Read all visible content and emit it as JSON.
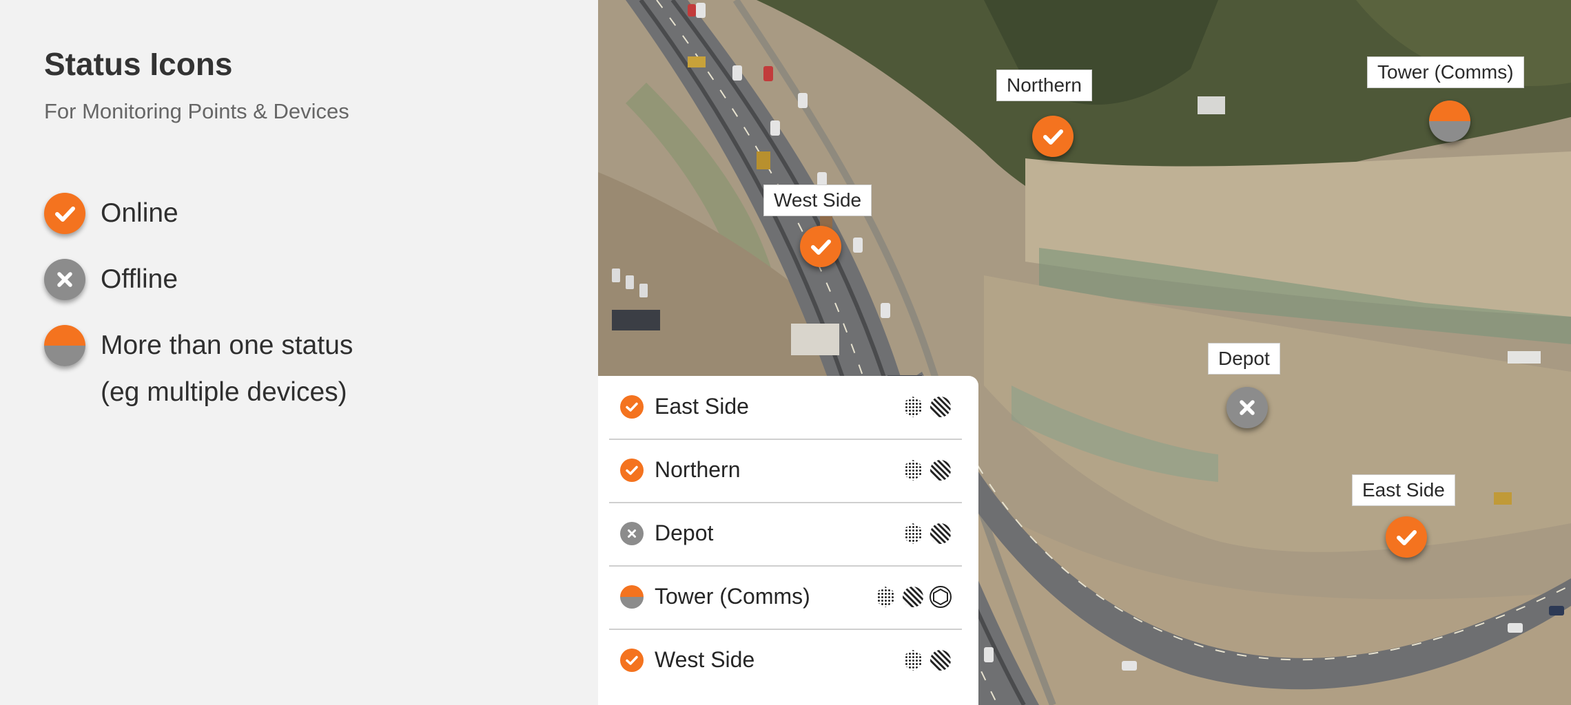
{
  "header": {
    "title": "Status Icons",
    "subtitle": "For Monitoring Points & Devices"
  },
  "legend": [
    {
      "status": "online",
      "icon": "check-icon",
      "label": "Online"
    },
    {
      "status": "offline",
      "icon": "x-icon",
      "label": "Offline"
    },
    {
      "status": "mixed",
      "icon": "split-status-icon",
      "label": "More than one status",
      "sublabel": "(eg multiple devices)"
    }
  ],
  "map_pins": [
    {
      "name": "Northern",
      "status": "online"
    },
    {
      "name": "Tower (Comms)",
      "status": "mixed"
    },
    {
      "name": "West Side",
      "status": "online"
    },
    {
      "name": "Depot",
      "status": "offline"
    },
    {
      "name": "East Side",
      "status": "online"
    }
  ],
  "panel": {
    "rows": [
      {
        "name": "East Side",
        "status": "online",
        "devices": [
          "dotted-hexagon-icon",
          "striped-circle-icon"
        ]
      },
      {
        "name": "Northern",
        "status": "online",
        "devices": [
          "dotted-hexagon-icon",
          "striped-circle-icon"
        ]
      },
      {
        "name": "Depot",
        "status": "offline",
        "devices": [
          "dotted-hexagon-icon",
          "striped-circle-icon"
        ]
      },
      {
        "name": "Tower (Comms)",
        "status": "mixed",
        "devices": [
          "dotted-hexagon-icon",
          "striped-circle-icon",
          "hexagon-outline-icon"
        ]
      },
      {
        "name": "West Side",
        "status": "online",
        "devices": [
          "dotted-hexagon-icon",
          "striped-circle-icon"
        ]
      }
    ]
  },
  "colors": {
    "online": "#f4731f",
    "offline": "#8c8c8c",
    "background": "#f2f2f2",
    "panel": "#ffffff"
  }
}
